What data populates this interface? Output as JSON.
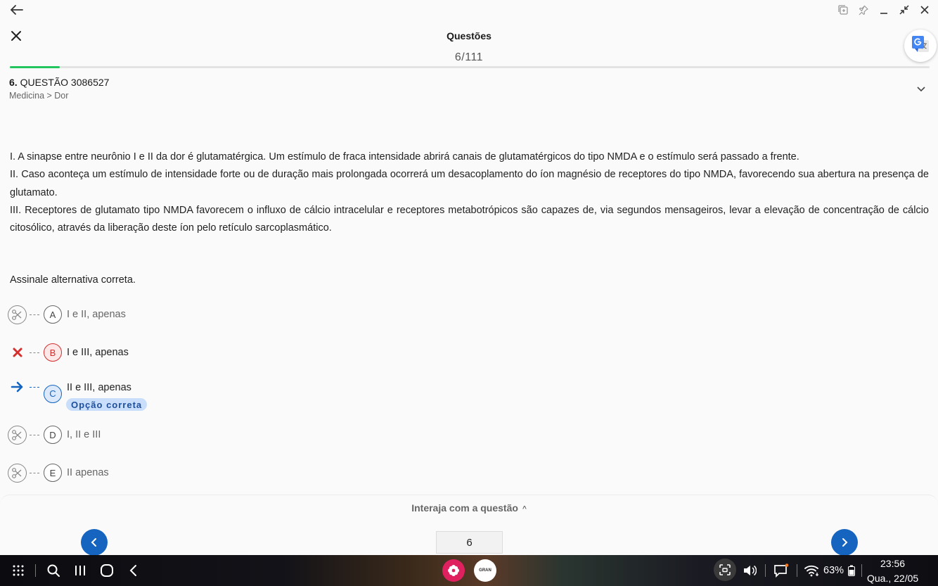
{
  "header": {
    "title": "Questões",
    "counter": "6/111",
    "progress_fraction": 0.054
  },
  "question": {
    "number": "6.",
    "code": "QUESTÃO 3086527",
    "breadcrumb": "Medicina > Dor",
    "statement": [
      "I. A sinapse entre neurônio I e II da dor é glutamatérgica. Um estímulo de fraca intensidade abrirá canais de glutamatérgicos do tipo NMDA e o estímulo será passado a frente.",
      "II. Caso aconteça um estímulo de intensidade forte ou de duração mais prolongada ocorrerá um desacoplamento do íon magnésio de receptores do tipo NMDA, favorecendo sua abertura na presença de glutamato.",
      "III. Receptores de glutamato tipo NMDA favorecem o influxo de cálcio intracelular e receptores metabotrópicos são capazes de, via segundos mensageiros, levar a elevação de concentração de cálcio citosólico, através da liberação deste íon pelo retículo sarcoplasmático."
    ],
    "prompt": "Assinale alternativa correta.",
    "options": [
      {
        "letter": "A",
        "text": "I e II, apenas",
        "state": "eliminable"
      },
      {
        "letter": "B",
        "text": "I e III, apenas",
        "state": "wrong"
      },
      {
        "letter": "C",
        "text": "II e III, apenas",
        "state": "correct"
      },
      {
        "letter": "D",
        "text": "I, II e III",
        "state": "eliminable"
      },
      {
        "letter": "E",
        "text": "II apenas",
        "state": "eliminable"
      }
    ],
    "correct_badge": "Opção correta"
  },
  "footer": {
    "interact_label": "Interaja com a questão",
    "page_value": "6"
  },
  "taskbar": {
    "gran_label": "GRAN",
    "battery": "63%",
    "time": "23:56",
    "date": "Qua., 22/05"
  },
  "colors": {
    "accent": "#1565c0",
    "progress": "#22c55e",
    "wrong": "#d32f2f"
  }
}
